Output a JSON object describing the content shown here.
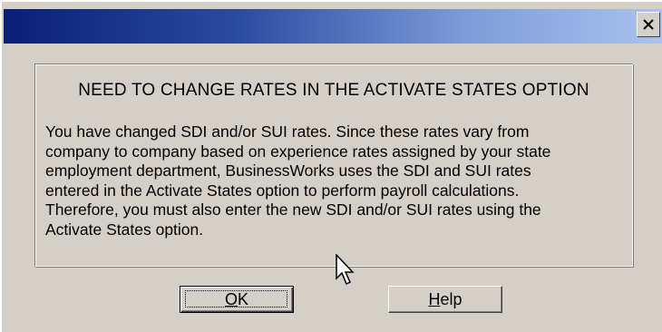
{
  "window": {
    "title": "",
    "close_icon": "close-icon"
  },
  "dialog": {
    "heading": "NEED TO CHANGE RATES IN THE ACTIVATE STATES OPTION",
    "message_lines": [
      "You have changed SDI and/or SUI rates.  Since these rates vary from",
      "company to company based on experience rates assigned by your state",
      "employment department, BusinessWorks uses the SDI and SUI rates",
      "entered in the Activate States option to perform payroll calculations.",
      "Therefore, you must also enter the new SDI and/or SUI rates using the",
      "Activate States option."
    ]
  },
  "buttons": {
    "ok": {
      "mnemonic": "O",
      "rest": "K"
    },
    "help": {
      "mnemonic": "H",
      "rest": "elp"
    }
  },
  "colors": {
    "titlebar_start": "#0a1e78",
    "titlebar_end": "#a9c2ee",
    "dialog_face": "#d4d0c8"
  },
  "icons": {
    "cursor": "mouse-pointer-icon"
  }
}
